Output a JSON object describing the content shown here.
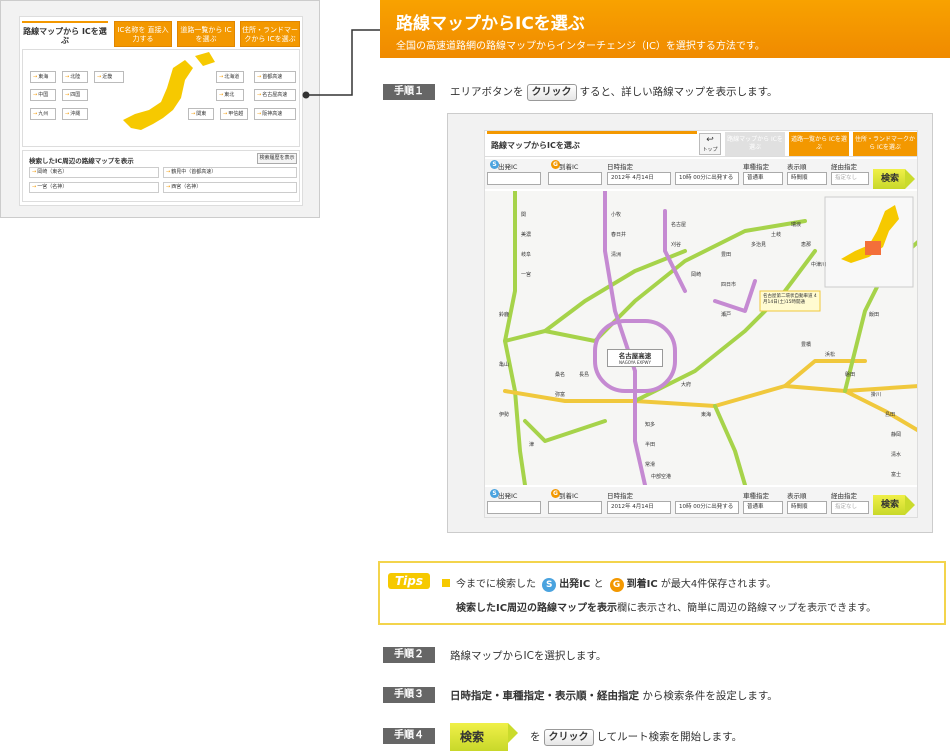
{
  "thumb": {
    "tabs": [
      {
        "label": "路線マップから ICを選ぶ"
      },
      {
        "label": "IC名称を 直接入力する"
      },
      {
        "label": "道路一覧から ICを選ぶ"
      },
      {
        "label": "住所・ランドマークから ICを選ぶ"
      }
    ],
    "regions_left": [
      "東海",
      "北陸",
      "近畿",
      "中国",
      "四国",
      "九州",
      "沖縄"
    ],
    "regions_right": [
      "北海道",
      "首都高速",
      "東北",
      "名古屋高速",
      "関東",
      "甲信越",
      "阪神高速"
    ],
    "history_title": "検索したIC周辺の路線マップを表示",
    "history_button": "検索履歴を表示",
    "history_items": [
      "岡崎（東名）",
      "鶴見中（首都高速）",
      "一宮（名神）",
      "西宮（名神）"
    ]
  },
  "header": {
    "title": "路線マップからICを選ぶ",
    "subtitle": "全国の高速道路網の路線マップからインターチェンジ（IC）を選択する方法です。"
  },
  "steps": {
    "s1": {
      "label": "手順１",
      "pre": "エリアボタンを",
      "click": "クリック",
      "post": "すると、詳しい路線マップを表示します。"
    },
    "s2": {
      "label": "手順２",
      "text": "路線マップからICを選択します。"
    },
    "s3": {
      "label": "手順３",
      "bold": "日時指定・車種指定・表示順・経由指定",
      "post": "から検索条件を設定します。"
    },
    "s4": {
      "label": "手順４",
      "button": "検索",
      "pre": "を",
      "click": "クリック",
      "post": "してルート検索を開始します。"
    }
  },
  "app": {
    "tab_title": "路線マップからICを選ぶ",
    "back_label": "トップ",
    "tabs": [
      {
        "label": "路線マップから ICを選ぶ"
      },
      {
        "label": "道路一覧から ICを選ぶ"
      },
      {
        "label": "住所・ランドマークから ICを選ぶ"
      }
    ],
    "depart_label": "出発IC",
    "arrive_label": "到着IC",
    "date_label": "日時指定",
    "date_value": "2012年 4月14日",
    "time_value": "10時 00分に出発する",
    "car_label": "車種指定",
    "car_value": "普通車",
    "order_label": "表示順",
    "order_value": "時間順",
    "via_label": "経由指定",
    "via_value": "指定なし",
    "search_label": "検索",
    "map_center": "名古屋高速",
    "map_center_en": "NAGOYA EXPWY",
    "notice": "名古屋第二環状自動車道 4月14日(土)15時開通",
    "stations": [
      "関",
      "美濃",
      "岐阜",
      "一宮",
      "小牧",
      "春日井",
      "清洲",
      "名古屋",
      "刈谷",
      "岡崎",
      "豊田",
      "四日市",
      "鈴鹿",
      "亀山",
      "伊勢",
      "津",
      "桑名",
      "長島",
      "弥富",
      "大府",
      "東海",
      "知多",
      "半田",
      "常滑",
      "中部空港",
      "瀬戸",
      "多治見",
      "土岐",
      "瑞浪",
      "恵那",
      "中津川",
      "飯田",
      "豊橋",
      "浜松",
      "磐田",
      "掛川",
      "島田",
      "静岡",
      "清水",
      "富士"
    ]
  },
  "tips": {
    "badge": "Tips",
    "line1_pre": "今までに検索した",
    "s_label": "出発IC",
    "and": "と",
    "g_label": "到着IC",
    "line1_post": "が最大4件保存されます。",
    "line2_bold": "検索したIC周辺の路線マップを表示",
    "line2_post": "欄に表示され、簡単に周辺の路線マップを表示できます。"
  },
  "colors": {
    "orange": "#f39800",
    "line_green": "#a6d34a",
    "line_purple": "#c58ad2",
    "line_yellow": "#f0c83c"
  }
}
